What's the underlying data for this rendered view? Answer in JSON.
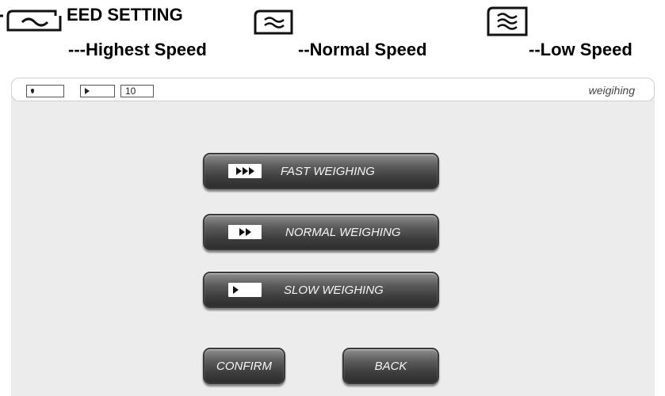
{
  "header": {
    "title": "EED SETTING",
    "speeds": [
      "---Highest Speed",
      "--Normal Speed",
      "--Low Speed"
    ]
  },
  "status_bar": {
    "count_value": "10",
    "mode_label": "weigihing"
  },
  "buttons": {
    "fast": "FAST WEIGHING",
    "normal": "NORMAL WEIGHING",
    "slow": "SLOW WEIGHING",
    "confirm": "CONFIRM",
    "back": "BACK"
  },
  "icons": [
    "wave-1-icon",
    "wave-2-icon",
    "wave-3-icon",
    "drop-icon",
    "play-icon"
  ]
}
